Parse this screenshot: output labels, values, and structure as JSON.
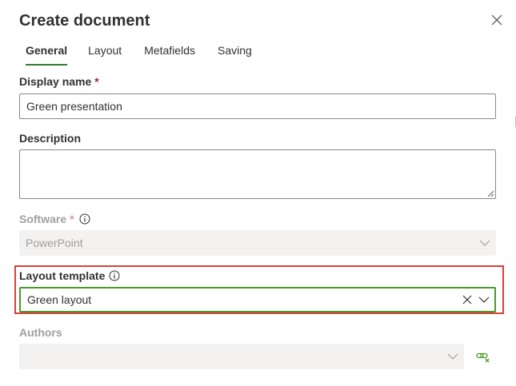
{
  "dialog": {
    "title": "Create document"
  },
  "tabs": [
    {
      "label": "General",
      "active": true
    },
    {
      "label": "Layout",
      "active": false
    },
    {
      "label": "Metafields",
      "active": false
    },
    {
      "label": "Saving",
      "active": false
    }
  ],
  "fields": {
    "display_name": {
      "label": "Display name",
      "required_marker": "*",
      "value": "Green presentation"
    },
    "description": {
      "label": "Description",
      "value": ""
    },
    "software": {
      "label": "Software",
      "required_marker": "*",
      "value": "PowerPoint",
      "disabled": true
    },
    "layout_template": {
      "label": "Layout template",
      "value": "Green layout"
    },
    "authors": {
      "label": "Authors",
      "value": "",
      "disabled": true
    }
  },
  "colors": {
    "accent": "#2e7d32",
    "focus_border": "#4a9a2a",
    "highlight": "#d9403a",
    "required": "#a4262c",
    "disabled_bg": "#f3f2f1",
    "disabled_text": "#a19f9d"
  },
  "icons": {
    "close": "close-icon",
    "info": "info-icon",
    "chevron": "chevron-down-icon",
    "clear": "clear-icon",
    "link": "unlink-icon"
  }
}
